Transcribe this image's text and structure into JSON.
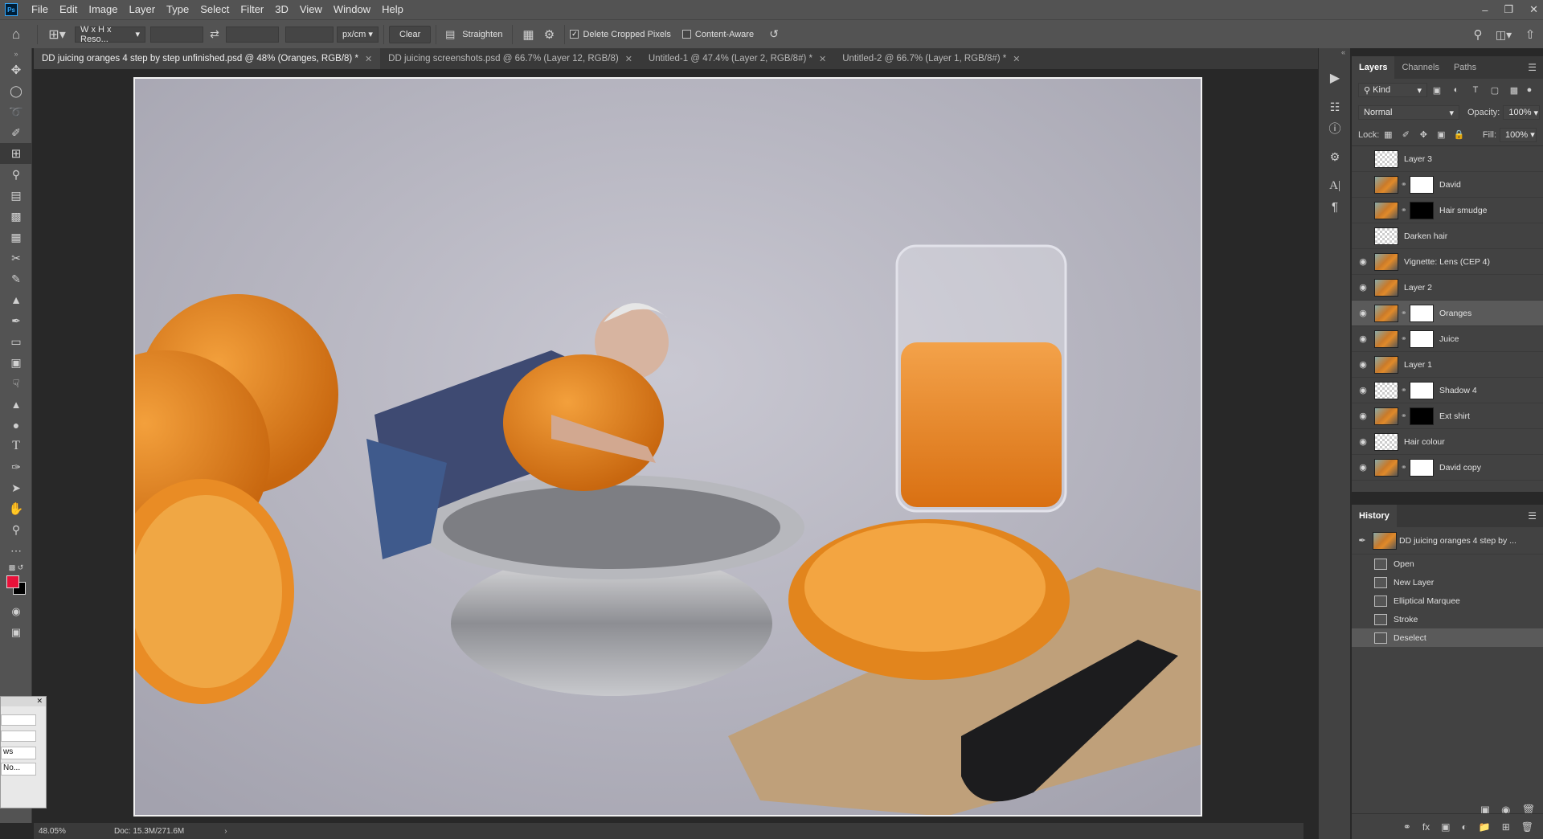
{
  "menu": {
    "logo": "Ps",
    "items": [
      "File",
      "Edit",
      "Image",
      "Layer",
      "Type",
      "Select",
      "Filter",
      "3D",
      "View",
      "Window",
      "Help"
    ]
  },
  "options": {
    "ratio_select": "W x H x Reso...",
    "units_select": "px/cm",
    "clear_label": "Clear",
    "straighten_label": "Straighten",
    "delete_cropped_label": "Delete Cropped Pixels",
    "delete_cropped_checked": true,
    "content_aware_label": "Content-Aware",
    "content_aware_checked": false
  },
  "tabs": [
    {
      "label": "DD juicing oranges 4 step by step unfinished.psd @ 48% (Oranges, RGB/8) *",
      "active": true
    },
    {
      "label": "DD juicing screenshots.psd @ 66.7% (Layer 12, RGB/8)",
      "active": false
    },
    {
      "label": "Untitled-1 @ 47.4% (Layer 2, RGB/8#) *",
      "active": false
    },
    {
      "label": "Untitled-2 @ 66.7% (Layer 1, RGB/8#) *",
      "active": false
    }
  ],
  "status": {
    "zoom": "48.05%",
    "doc": "Doc: 15.3M/271.6M"
  },
  "layers_panel": {
    "tabs": [
      "Layers",
      "Channels",
      "Paths"
    ],
    "filter_label": "Kind",
    "blend_mode": "Normal",
    "opacity_label": "Opacity:",
    "opacity_value": "100%",
    "lock_label": "Lock:",
    "fill_label": "Fill:",
    "fill_value": "100%",
    "layers": [
      {
        "name": "Layer 3",
        "visible": false,
        "thumb": "checker",
        "mask": null
      },
      {
        "name": "David",
        "visible": false,
        "thumb": "photo",
        "mask": "white"
      },
      {
        "name": "Hair smudge",
        "visible": false,
        "thumb": "photo",
        "mask": "black"
      },
      {
        "name": "Darken hair",
        "visible": false,
        "thumb": "checker",
        "mask": null
      },
      {
        "name": "Vignette: Lens (CEP 4)",
        "visible": true,
        "thumb": "photo",
        "mask": null
      },
      {
        "name": "Layer 2",
        "visible": true,
        "thumb": "photo",
        "mask": null
      },
      {
        "name": "Oranges",
        "visible": true,
        "thumb": "photo",
        "mask": "white",
        "selected": true
      },
      {
        "name": "Juice",
        "visible": true,
        "thumb": "photo",
        "mask": "white"
      },
      {
        "name": "Layer 1",
        "visible": true,
        "thumb": "photo",
        "mask": null
      },
      {
        "name": "Shadow 4",
        "visible": true,
        "thumb": "checker",
        "mask": "white"
      },
      {
        "name": "Ext shirt",
        "visible": true,
        "thumb": "photo",
        "mask": "black"
      },
      {
        "name": "Hair colour",
        "visible": true,
        "thumb": "checker",
        "mask": null
      },
      {
        "name": "David copy",
        "visible": true,
        "thumb": "photo",
        "mask": "white"
      }
    ]
  },
  "history_panel": {
    "title": "History",
    "snapshot": "DD juicing oranges 4 step by ...",
    "items": [
      {
        "label": "Open",
        "selected": false
      },
      {
        "label": "New Layer",
        "selected": false
      },
      {
        "label": "Elliptical Marquee",
        "selected": false
      },
      {
        "label": "Stroke",
        "selected": false
      },
      {
        "label": "Deselect",
        "selected": true
      }
    ]
  },
  "float_panel": {
    "line1": "ws",
    "line2": "No..."
  },
  "colors": {
    "foreground": "#e8123a",
    "background": "#000000"
  }
}
